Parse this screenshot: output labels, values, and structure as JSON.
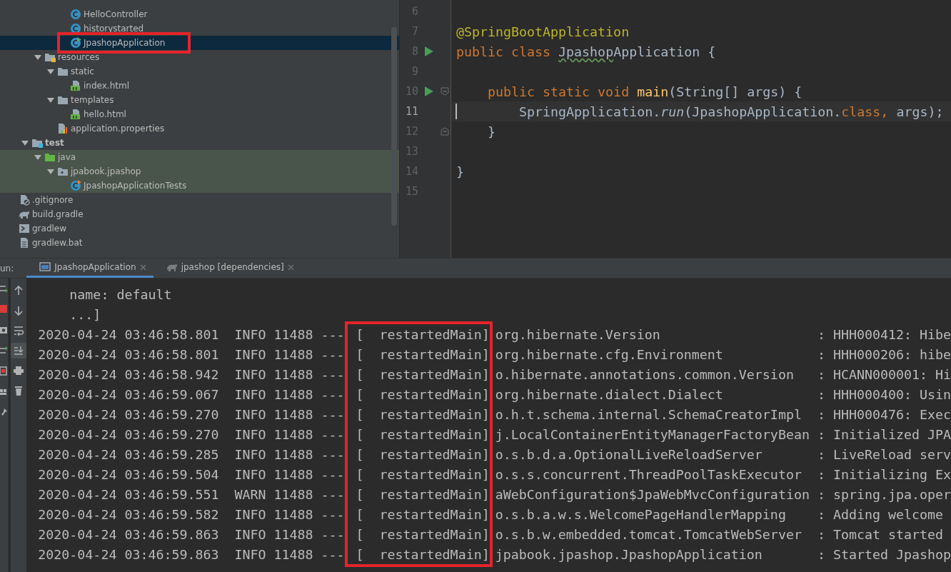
{
  "project_tree": [
    {
      "children": [
        {
          "children": [
            {
              "children": [
                {
                  "children": [
                    {
                      "children": [
                        {
                          "label": "HelloController",
                          "kind": "class",
                          "selected": false,
                          "tinted": false,
                          "highlighted": false
                        },
                        {
                          "label": "historystarted",
                          "kind": "class",
                          "selected": false,
                          "tinted": false,
                          "highlighted": false
                        },
                        {
                          "label": "JpashopApplication",
                          "kind": "app-class",
                          "selected": true,
                          "tinted": false,
                          "highlighted": true
                        }
                      ]
                    }
                  ]
                },
                {
                  "label": "resources",
                  "kind": "resources",
                  "expanded": true,
                  "selected": false,
                  "tinted": false,
                  "highlighted": false,
                  "children": [
                    {
                      "label": "static",
                      "kind": "folder",
                      "expanded": true,
                      "selected": false,
                      "tinted": false,
                      "highlighted": false,
                      "children": [
                        {
                          "label": "index.html",
                          "kind": "html",
                          "selected": false,
                          "tinted": false,
                          "highlighted": false
                        }
                      ]
                    },
                    {
                      "label": "templates",
                      "kind": "folder",
                      "expanded": true,
                      "selected": false,
                      "tinted": false,
                      "highlighted": false,
                      "children": [
                        {
                          "label": "hello.html",
                          "kind": "html",
                          "selected": false,
                          "tinted": false,
                          "highlighted": false
                        }
                      ]
                    },
                    {
                      "label": "application.properties",
                      "kind": "properties",
                      "selected": false,
                      "tinted": false,
                      "highlighted": false
                    }
                  ]
                }
              ]
            },
            {
              "label": "test",
              "kind": "test-root",
              "expanded": true,
              "selected": false,
              "tinted": false,
              "highlighted": false,
              "children": [
                {
                  "label": "java",
                  "kind": "test-folder",
                  "expanded": true,
                  "selected": false,
                  "tinted": true,
                  "highlighted": false,
                  "children": [
                    {
                      "label": "jpabook.jpashop",
                      "kind": "package",
                      "expanded": true,
                      "selected": false,
                      "tinted": true,
                      "highlighted": false,
                      "children": [
                        {
                          "label": "JpashopApplicationTests",
                          "kind": "test-class",
                          "selected": false,
                          "tinted": true,
                          "highlighted": false
                        }
                      ]
                    }
                  ]
                }
              ]
            }
          ]
        },
        {
          "label": ".gitignore",
          "kind": "ignore-file",
          "selected": false,
          "tinted": false,
          "highlighted": false
        },
        {
          "label": "build.gradle",
          "kind": "gradle",
          "selected": false,
          "tinted": false,
          "highlighted": false
        },
        {
          "label": "gradlew",
          "kind": "script",
          "selected": false,
          "tinted": false,
          "highlighted": false
        },
        {
          "label": "gradlew.bat",
          "kind": "file",
          "selected": false,
          "tinted": false,
          "highlighted": false
        }
      ]
    }
  ],
  "editor": {
    "lines": [
      {
        "number": "6",
        "run": false,
        "fold_open": false,
        "fold_close": false,
        "current": false
      },
      {
        "number": "7",
        "run": false,
        "fold_open": false,
        "fold_close": false,
        "current": false,
        "tokens": [
          {
            "text": "@SpringBootApplication",
            "kind": "annotation"
          }
        ]
      },
      {
        "number": "8",
        "run": true,
        "fold_open": false,
        "fold_close": false,
        "current": false,
        "tokens": [
          {
            "text": "public class ",
            "kind": "keyword"
          },
          {
            "text": "Jpashop",
            "kind": "typo"
          },
          {
            "text": "Application {",
            "kind": "plain"
          }
        ]
      },
      {
        "number": "9",
        "run": false,
        "fold_open": false,
        "fold_close": false,
        "current": false
      },
      {
        "number": "10",
        "run": true,
        "fold_open": true,
        "fold_close": false,
        "current": false,
        "tokens": [
          {
            "text": "    public static void ",
            "kind": "keyword"
          },
          {
            "text": "main",
            "kind": "method"
          },
          {
            "text": "(String[] args) {",
            "kind": "plain"
          }
        ]
      },
      {
        "number": "11",
        "run": false,
        "fold_open": false,
        "fold_close": false,
        "current": true,
        "tokens": [
          {
            "text": "        SpringApplication.",
            "kind": "plain"
          },
          {
            "text": "run",
            "kind": "italic"
          },
          {
            "text": "(JpashopApplication.",
            "kind": "plain"
          },
          {
            "text": "class",
            "kind": "keyword"
          },
          {
            "text": ", ",
            "kind": "keyword"
          },
          {
            "text": "args);",
            "kind": "plain"
          }
        ]
      },
      {
        "number": "12",
        "run": false,
        "fold_open": false,
        "fold_close": true,
        "current": false,
        "tokens": [
          {
            "text": "    }",
            "kind": "plain"
          }
        ]
      },
      {
        "number": "13",
        "run": false,
        "fold_open": false,
        "fold_close": false,
        "current": false
      },
      {
        "number": "14",
        "run": false,
        "fold_open": false,
        "fold_close": false,
        "current": false,
        "tokens": [
          {
            "text": "}",
            "kind": "plain"
          }
        ]
      },
      {
        "number": "15",
        "run": false,
        "fold_open": false,
        "fold_close": false,
        "current": false
      }
    ]
  },
  "run_panel": {
    "label": "un:",
    "tabs": [
      {
        "label": "JpashopApplication",
        "kind": "console",
        "selected": true
      },
      {
        "label": "jpashop [dependencies]",
        "kind": "gradle",
        "selected": false
      }
    ],
    "side_tools": [
      {
        "kind": "rerun"
      },
      {
        "kind": "stop"
      },
      {
        "kind": "camera"
      },
      {
        "kind": "swap"
      },
      {
        "kind": "exit"
      },
      {
        "kind": "layout"
      },
      {
        "kind": "pin"
      }
    ],
    "tools": [
      {
        "kind": "up",
        "selected": false
      },
      {
        "kind": "down",
        "selected": false
      },
      {
        "kind": "wrap",
        "selected": false
      },
      {
        "kind": "scroll-end",
        "selected": true
      },
      {
        "kind": "print",
        "selected": false
      },
      {
        "kind": "trash",
        "selected": false
      }
    ],
    "text_lines": [
      "    name: default",
      "    ...]"
    ],
    "log": [
      {
        "timestamp": "2020-04-24 03:46:58.801",
        "level": "INFO",
        "pid": "11488",
        "separator": "---",
        "thread": "[  restartedMain]",
        "logger": "org.hibernate.Version",
        "colon": ":",
        "message": "HHH000412: Hibe"
      },
      {
        "timestamp": "2020-04-24 03:46:58.801",
        "level": "INFO",
        "pid": "11488",
        "separator": "---",
        "thread": "[  restartedMain]",
        "logger": "org.hibernate.cfg.Environment",
        "colon": ":",
        "message": "HHH000206: hibe"
      },
      {
        "timestamp": "2020-04-24 03:46:58.942",
        "level": "INFO",
        "pid": "11488",
        "separator": "---",
        "thread": "[  restartedMain]",
        "logger": "o.hibernate.annotations.common.Version",
        "colon": ":",
        "message": "HCANN000001: Hi"
      },
      {
        "timestamp": "2020-04-24 03:46:59.067",
        "level": "INFO",
        "pid": "11488",
        "separator": "---",
        "thread": "[  restartedMain]",
        "logger": "org.hibernate.dialect.Dialect",
        "colon": ":",
        "message": "HHH000400: Usin"
      },
      {
        "timestamp": "2020-04-24 03:46:59.270",
        "level": "INFO",
        "pid": "11488",
        "separator": "---",
        "thread": "[  restartedMain]",
        "logger": "o.h.t.schema.internal.SchemaCreatorImpl",
        "colon": ":",
        "message": "HHH000476: Exec"
      },
      {
        "timestamp": "2020-04-24 03:46:59.270",
        "level": "INFO",
        "pid": "11488",
        "separator": "---",
        "thread": "[  restartedMain]",
        "logger": "j.LocalContainerEntityManagerFactoryBean",
        "colon": ":",
        "message": "Initialized JPA"
      },
      {
        "timestamp": "2020-04-24 03:46:59.285",
        "level": "INFO",
        "pid": "11488",
        "separator": "---",
        "thread": "[  restartedMain]",
        "logger": "o.s.b.d.a.OptionalLiveReloadServer",
        "colon": ":",
        "message": "LiveReload serv"
      },
      {
        "timestamp": "2020-04-24 03:46:59.504",
        "level": "INFO",
        "pid": "11488",
        "separator": "---",
        "thread": "[  restartedMain]",
        "logger": "o.s.s.concurrent.ThreadPoolTaskExecutor",
        "colon": ":",
        "message": "Initializing Ex"
      },
      {
        "timestamp": "2020-04-24 03:46:59.551",
        "level": "WARN",
        "pid": "11488",
        "separator": "---",
        "thread": "[  restartedMain]",
        "logger": "aWebConfiguration$JpaWebMvcConfiguration",
        "colon": ":",
        "message": "spring.jpa.oper"
      },
      {
        "timestamp": "2020-04-24 03:46:59.582",
        "level": "INFO",
        "pid": "11488",
        "separator": "---",
        "thread": "[  restartedMain]",
        "logger": "o.s.b.a.w.s.WelcomePageHandlerMapping",
        "colon": ":",
        "message": "Adding welcome"
      },
      {
        "timestamp": "2020-04-24 03:46:59.863",
        "level": "INFO",
        "pid": "11488",
        "separator": "---",
        "thread": "[  restartedMain]",
        "logger": "o.s.b.w.embedded.tomcat.TomcatWebServer",
        "colon": ":",
        "message": "Tomcat started"
      },
      {
        "timestamp": "2020-04-24 03:46:59.863",
        "level": "INFO",
        "pid": "11488",
        "separator": "---",
        "thread": "[  restartedMain]",
        "logger": "jpabook.jpashop.JpashopApplication",
        "colon": ":",
        "message": "Started Jpashop"
      }
    ]
  }
}
